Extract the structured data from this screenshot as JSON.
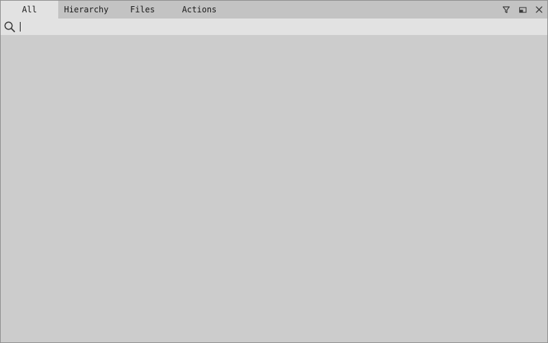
{
  "tabs": [
    {
      "label": "All",
      "active": true
    },
    {
      "label": "Hierarchy",
      "active": false
    },
    {
      "label": "Files",
      "active": false
    },
    {
      "label": "Actions",
      "active": false
    }
  ],
  "toolbar": {
    "filter_icon": "filter-icon",
    "dock_icon": "dock-icon",
    "close_icon": "close-icon"
  },
  "search": {
    "icon": "search-icon",
    "value": "",
    "placeholder": ""
  },
  "colors": {
    "tabbar_bg": "#c3c3c3",
    "active_tab_bg": "#e2e2e2",
    "searchbar_bg": "#e2e2e2",
    "content_bg": "#cccccc",
    "text": "#1a1a1a",
    "icon": "#3a3a3a"
  }
}
